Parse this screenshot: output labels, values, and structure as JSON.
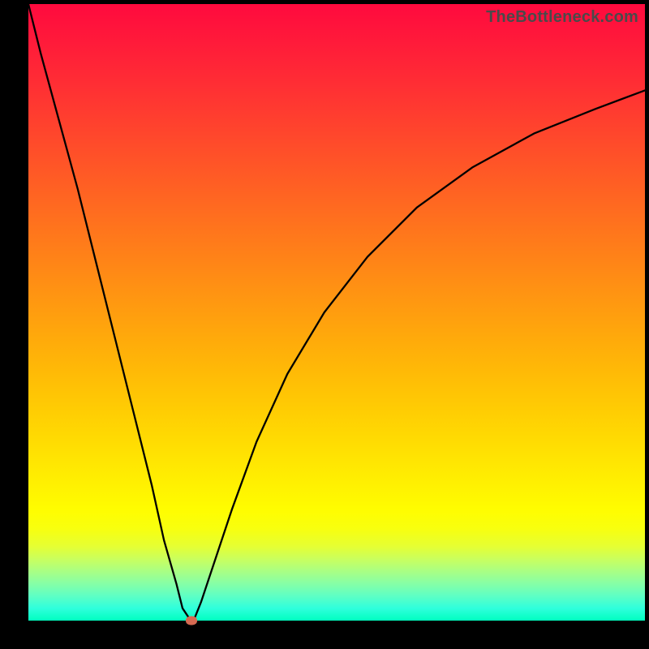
{
  "watermark": "TheBottleneck.com",
  "chart_data": {
    "type": "line",
    "title": "",
    "xlabel": "",
    "ylabel": "",
    "xlim": [
      0,
      100
    ],
    "ylim": [
      0,
      100
    ],
    "grid": false,
    "legend": false,
    "series": [
      {
        "name": "bottleneck-curve",
        "x": [
          0,
          2,
          5,
          8,
          11,
          14,
          17,
          20,
          22,
          24,
          25,
          26,
          26.5,
          27,
          28,
          30,
          33,
          37,
          42,
          48,
          55,
          63,
          72,
          82,
          92,
          100
        ],
        "values": [
          100,
          92,
          81,
          70,
          58,
          46,
          34,
          22,
          13,
          6,
          2,
          0.5,
          0,
          0.5,
          3,
          9,
          18,
          29,
          40,
          50,
          59,
          67,
          73.5,
          79,
          83,
          86
        ],
        "color": "#000000"
      }
    ],
    "annotations": [
      {
        "type": "marker",
        "name": "optimum-point",
        "x": 26.5,
        "y": 0,
        "color": "#d56a52"
      }
    ],
    "background_gradient": {
      "top": "#ff0a3e",
      "mid": "#ffd400",
      "bottom": "#00ffbf"
    }
  }
}
